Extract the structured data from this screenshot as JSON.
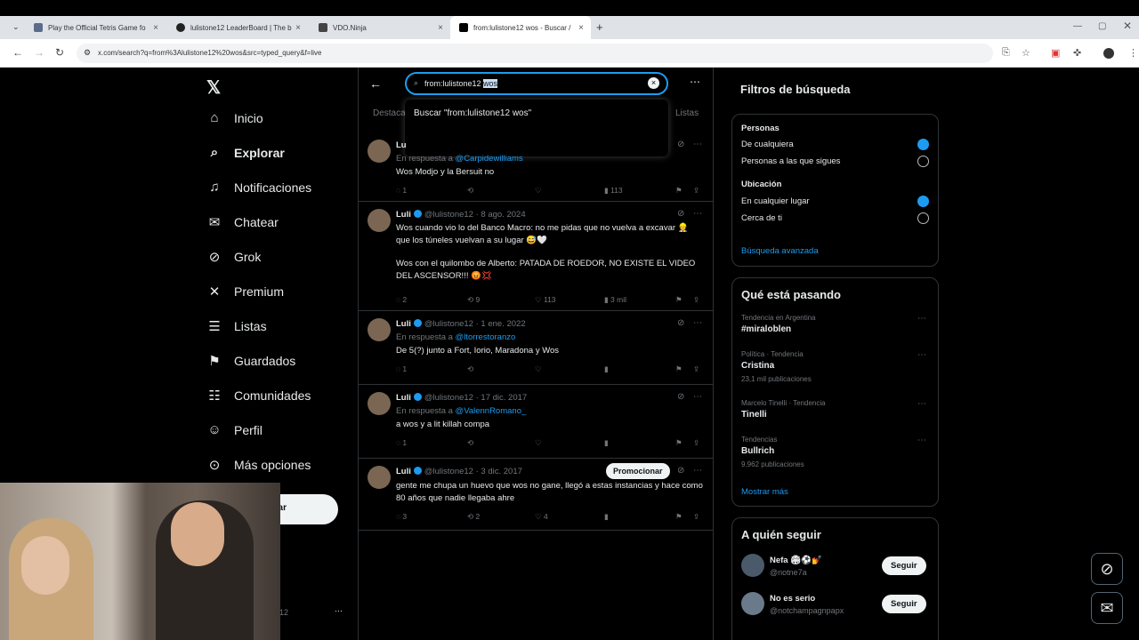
{
  "browser": {
    "tabs": [
      {
        "title": "Play the Official Tetris Game fo"
      },
      {
        "title": "lulistone12 LeaderBoard | The b"
      },
      {
        "title": "VDO.Ninja"
      },
      {
        "title": "from:lulistone12 wos - Buscar /"
      }
    ],
    "url": "x.com/search?q=from%3Alulistone12%20wos&src=typed_query&f=live"
  },
  "sidebar": {
    "items": [
      {
        "label": "Inicio"
      },
      {
        "label": "Explorar"
      },
      {
        "label": "Notificaciones"
      },
      {
        "label": "Chatear"
      },
      {
        "label": "Grok"
      },
      {
        "label": "Premium"
      },
      {
        "label": "Listas"
      },
      {
        "label": "Guardados"
      },
      {
        "label": "Comunidades"
      },
      {
        "label": "Perfil"
      },
      {
        "label": "Más opciones"
      }
    ],
    "post_fragment": "ar",
    "account_fragment": "12"
  },
  "search": {
    "query_prefix": "from:lulistone12 ",
    "query_selected": "wos",
    "suggestion": "Buscar \"from:lulistone12 wos\"",
    "tab_left": "Destaca",
    "tab_right": "Listas"
  },
  "posts": [
    {
      "name": "Lu",
      "reply_prefix": "En respuesta a",
      "reply_to": "@Carpidewilliams",
      "text": "Wos Modjo y la Bersuit no",
      "replies": "1",
      "reposts": "",
      "likes": "",
      "views": "113"
    },
    {
      "name": "Luli",
      "handle": "@lulistone12",
      "date": "· 8 ago. 2024",
      "text1": "Wos cuando vio lo del Banco Macro: no me pidas que no vuelva a excavar 👷 que los túneles vuelvan a su lugar 😅🤍",
      "text2": "Wos con el quilombo de Alberto: PATADA DE ROEDOR, NO EXISTE EL VIDEO DEL ASCENSOR!!! 😡💢",
      "replies": "2",
      "reposts": "9",
      "likes": "113",
      "views": "3 mil"
    },
    {
      "name": "Luli",
      "handle": "@lulistone12",
      "date": "· 1 ene. 2022",
      "reply_prefix": "En respuesta a",
      "reply_to": "@ltorrestoranzo",
      "text": "De 5(?) junto a Fort, Iorio, Maradona y Wos",
      "replies": "1",
      "reposts": "",
      "likes": "",
      "views": ""
    },
    {
      "name": "Luli",
      "handle": "@lulistone12",
      "date": "· 17 dic. 2017",
      "reply_prefix": "En respuesta a",
      "reply_to": "@ValennRomano_",
      "text": "a wos y a lit killah compa",
      "replies": "1",
      "reposts": "",
      "likes": "",
      "views": ""
    },
    {
      "name": "Luli",
      "handle": "@lulistone12",
      "date": "· 3 dic. 2017",
      "promote": "Promocionar",
      "text": "gente me chupa un huevo que wos no gane, llegó a estas instancias y hace como 80 años que nadie llegaba ahre",
      "replies": "3",
      "reposts": "2",
      "likes": "4",
      "views": ""
    }
  ],
  "filters": {
    "title": "Filtros de búsqueda",
    "people_label": "Personas",
    "people_any": "De cualquiera",
    "people_following": "Personas a las que sigues",
    "location_label": "Ubicación",
    "location_any": "En cualquier lugar",
    "location_near": "Cerca de ti",
    "advanced": "Búsqueda avanzada"
  },
  "trends": {
    "title": "Qué está pasando",
    "items": [
      {
        "context": "Tendencia en Argentina",
        "name": "#miraloblen",
        "count": ""
      },
      {
        "context": "Política · Tendencia",
        "name": "Cristina",
        "count": "23,1 mil publicaciones"
      },
      {
        "context": "Marcelo Tinelli · Tendencia",
        "name": "Tinelli",
        "count": ""
      },
      {
        "context": "Tendencias",
        "name": "Bullrich",
        "count": "9.962 publicaciones"
      }
    ],
    "show_more": "Mostrar más"
  },
  "who_to_follow": {
    "title": "A quién seguir",
    "items": [
      {
        "name": "Nefa 🏟⚽💅",
        "handle": "@notne7a",
        "button": "Seguir"
      },
      {
        "name": "No es serio",
        "handle": "@notchampagnpapx",
        "button": "Seguir"
      }
    ]
  }
}
